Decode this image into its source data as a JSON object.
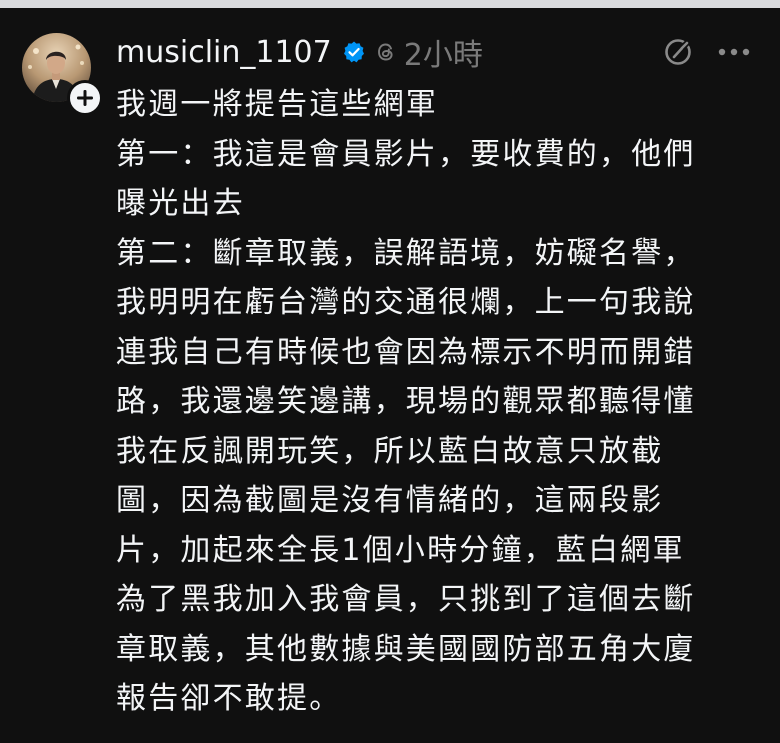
{
  "post": {
    "username": "musiclin_1107",
    "time": "2小時",
    "lines": [
      "我週一將提告這些網軍",
      "第一：我這是會員影片，要收費的，他們",
      "曝光出去",
      "第二：斷章取義，誤解語境，妨礙名譽，",
      "我明明在虧台灣的交通很爛，上一句我說",
      "連我自己有時候也會因為標示不明而開錯",
      "路，我還邊笑邊講，現場的觀眾都聽得懂",
      "我在反諷開玩笑，所以藍白故意只放截",
      "圖，因為截圖是沒有情緒的，這兩段影",
      "片，加起來全長1個小時分鐘，藍白網軍",
      "為了黑我加入我會員，只挑到了這個去斷",
      "章取義，其他數據與美國國防部五角大廈",
      "報告卻不敢提。"
    ]
  },
  "icons": {
    "avatar": "profile-photo",
    "follow": "plus-icon",
    "verified": "verified-badge-icon",
    "thread": "threads-logo-icon",
    "compose": "edit-slash-icon",
    "more": "more-horizontal-icon"
  },
  "colors": {
    "background": "#101010",
    "text": "#f3f5f7",
    "muted": "#7a7a7a",
    "verified": "#0095f6"
  }
}
